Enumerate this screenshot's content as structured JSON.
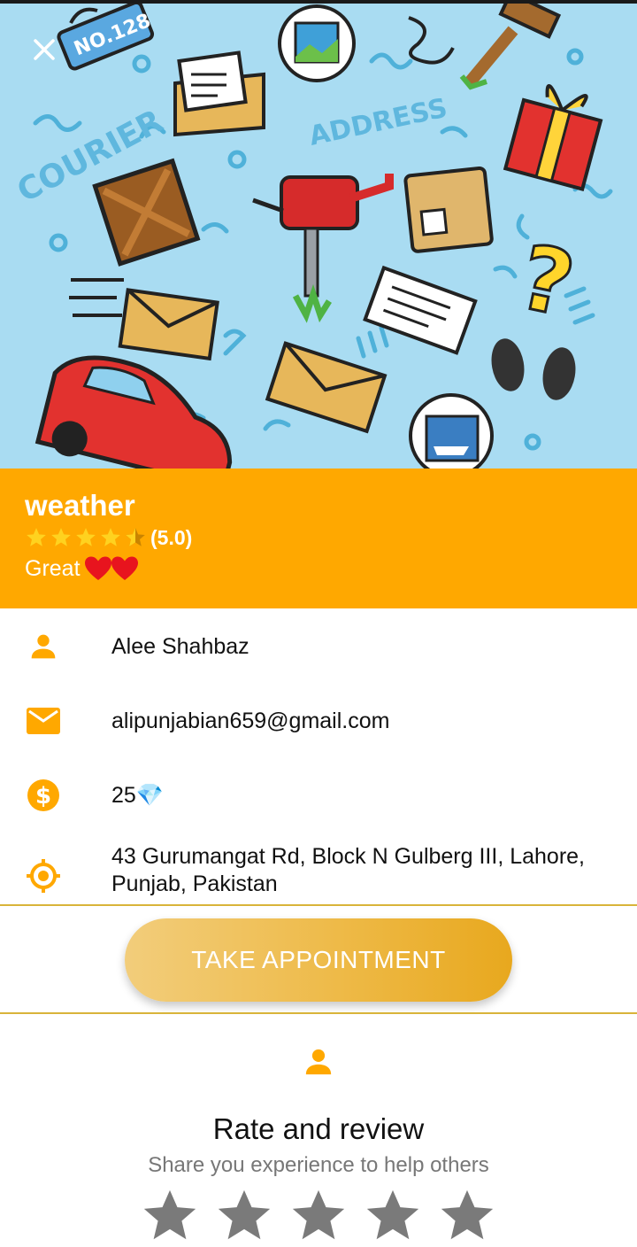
{
  "colors": {
    "accent": "#ffa800",
    "divider": "#d9b43a",
    "hero_bg": "#a9dcf2"
  },
  "hero": {
    "close_icon": "close-icon",
    "illustration_texts": {
      "sign": "NO.128",
      "courier": "COURIER",
      "address": "ADDRESS"
    }
  },
  "header": {
    "title": "weather",
    "rating_value": "(5.0)",
    "rating_stars": 4.5,
    "label": "Great",
    "hearts_icon": "heart-icon"
  },
  "info": {
    "name": "Alee Shahbaz",
    "email": "alipunjabian659@gmail.com",
    "price": "25💎",
    "address": "43 Gurumangat Rd, Block N Gulberg III, Lahore, Punjab, Pakistan",
    "icons": [
      "person-icon",
      "mail-icon",
      "dollar-icon",
      "location-target-icon"
    ]
  },
  "appointment": {
    "button_label": "TAKE APPOINTMENT"
  },
  "review": {
    "title": "Rate and review",
    "subtitle": "Share you experience to help others",
    "star_count": 5
  }
}
